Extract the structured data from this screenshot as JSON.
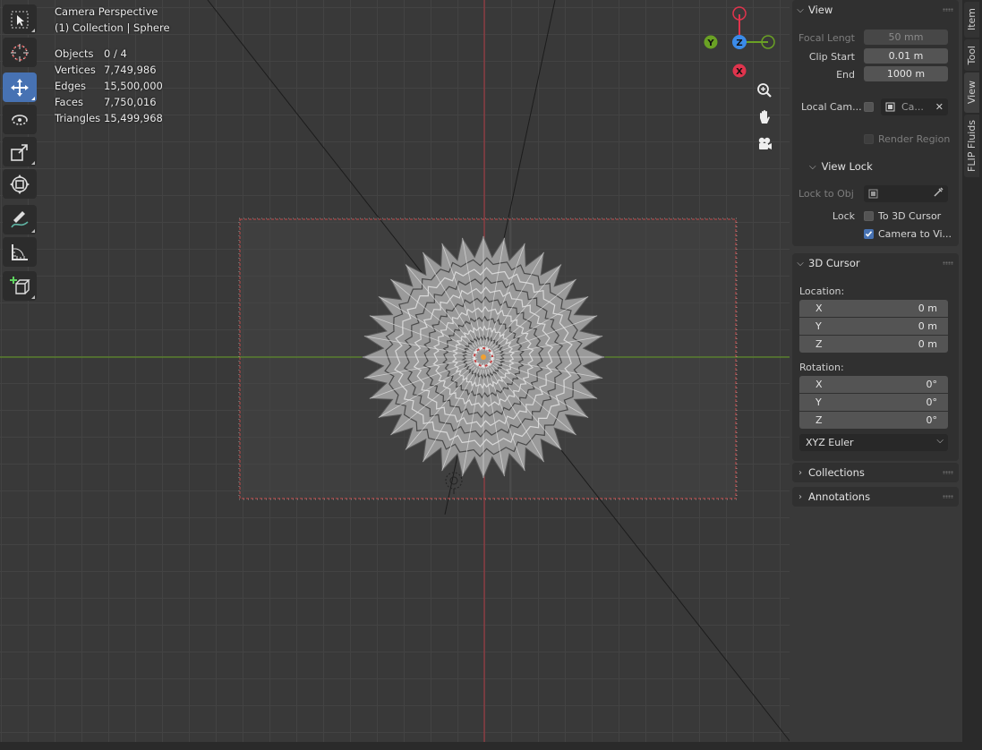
{
  "viewport": {
    "header": {
      "view_name": "Camera Perspective",
      "collection_line": "(1) Collection | Sphere"
    },
    "stats": [
      {
        "key": "Objects",
        "value": "0 / 4"
      },
      {
        "key": "Vertices",
        "value": "7,749,986"
      },
      {
        "key": "Edges",
        "value": "15,500,000"
      },
      {
        "key": "Faces",
        "value": "7,750,016"
      },
      {
        "key": "Triangles",
        "value": "15,499,968"
      }
    ],
    "gizmo": {
      "z_label": "Z",
      "y_label": "Y",
      "x_label": "X",
      "colors": {
        "x": "#e0344d",
        "y": "#6aa124",
        "z": "#3b8be9"
      }
    },
    "tools": [
      "select-box",
      "cursor",
      "move",
      "rotate",
      "scale",
      "transform",
      "annotate",
      "measure",
      "add-cube"
    ],
    "colors": {
      "accent": "#4772b3",
      "x_axis_line": "#9b3c42",
      "y_axis_line": "#5e8a2a",
      "camera_frame": "#c44a4a"
    }
  },
  "sidebar": {
    "view_panel": {
      "title": "View",
      "focal_length_label": "Focal Lengt",
      "focal_length_value": "50 mm",
      "clip_start_label": "Clip Start",
      "clip_start_value": "0.01 m",
      "clip_end_label": "End",
      "clip_end_value": "1000 m",
      "local_camera_label": "Local Cam...",
      "local_camera_value": "Ca...",
      "render_region_label": "Render Region"
    },
    "view_lock": {
      "title": "View Lock",
      "lock_to_obj_label": "Lock to Obj",
      "lock_label": "Lock",
      "to_3d_cursor_label": "To 3D Cursor",
      "to_3d_cursor_checked": false,
      "camera_to_view_label": "Camera to Vi...",
      "camera_to_view_checked": true
    },
    "cursor_panel": {
      "title": "3D Cursor",
      "location_label": "Location:",
      "location": [
        {
          "axis": "X",
          "value": "0 m"
        },
        {
          "axis": "Y",
          "value": "0 m"
        },
        {
          "axis": "Z",
          "value": "0 m"
        }
      ],
      "rotation_label": "Rotation:",
      "rotation": [
        {
          "axis": "X",
          "value": "0°"
        },
        {
          "axis": "Y",
          "value": "0°"
        },
        {
          "axis": "Z",
          "value": "0°"
        }
      ],
      "rotation_mode": "XYZ Euler"
    },
    "collections_title": "Collections",
    "annotations_title": "Annotations"
  },
  "tabs": [
    "Item",
    "Tool",
    "View",
    "FLIP Fluids"
  ]
}
